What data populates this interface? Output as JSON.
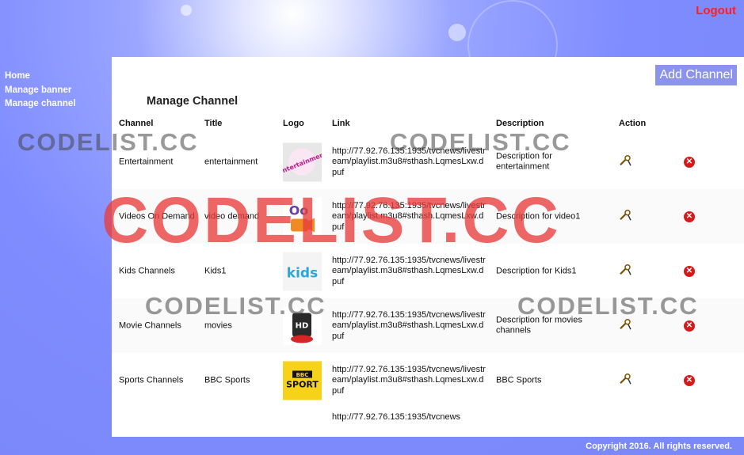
{
  "header": {
    "logout_label": "Logout"
  },
  "sidebar": {
    "items": [
      {
        "label": "Home"
      },
      {
        "label": "Manage banner"
      },
      {
        "label": "Manage channel"
      }
    ]
  },
  "main": {
    "add_button": "Add Channel",
    "title": "Manage Channel",
    "columns": [
      "Channel",
      "Title",
      "Logo",
      "Link",
      "Description",
      "Action"
    ],
    "rows": [
      {
        "channel": "Entertainment",
        "title": "entertainment",
        "logo": "entertainment-logo",
        "link": "http://77.92.76.135:1935/tvcnews/livestream/playlist.m3u8#sthash.LqmesLxw.dpuf",
        "description": "Description for entertainment"
      },
      {
        "channel": "Videos On Demand",
        "title": "video demand",
        "logo": "video-on-demand-logo",
        "link": "http://77.92.76.135:1935/tvcnews/livestream/playlist.m3u8#sthash.LqmesLxw.dpuf",
        "description": "Description for video1"
      },
      {
        "channel": "Kids Channels",
        "title": "Kids1",
        "logo": "kids-logo",
        "link": "http://77.92.76.135:1935/tvcnews/livestream/playlist.m3u8#sthash.LqmesLxw.dpuf",
        "description": "Description for Kids1"
      },
      {
        "channel": "Movie Channels",
        "title": "movies",
        "logo": "hd-movie-logo",
        "link": "http://77.92.76.135:1935/tvcnews/livestream/playlist.m3u8#sthash.LqmesLxw.dpuf",
        "description": "Description for movies channels"
      },
      {
        "channel": "Sports Channels",
        "title": "BBC Sports",
        "logo": "bbc-sport-logo",
        "link": "http://77.92.76.135:1935/tvcnews/livestream/playlist.m3u8#sthash.LqmesLxw.dpuf",
        "description": "BBC Sports"
      }
    ],
    "partial_link": "http://77.92.76.135:1935/tvcnews",
    "logo_texts": {
      "entertainment": "Entertainment",
      "vod": "Oo",
      "kids": "kids",
      "hd": "HD",
      "bbc": "BBC",
      "sport": "SPORT"
    },
    "icons": {
      "edit": "edit-wrench-icon",
      "delete": "delete-x-icon"
    }
  },
  "footer": {
    "copyright": "Copyright 2016. All rights reserved."
  },
  "watermark": {
    "text": "CODELIST.CC"
  },
  "colors": {
    "logout": "#ff1e1e",
    "button": "#8b93ec",
    "delete": "#d61a1a",
    "watermark_big": "#e83c3c",
    "background": "#7f8cff"
  }
}
